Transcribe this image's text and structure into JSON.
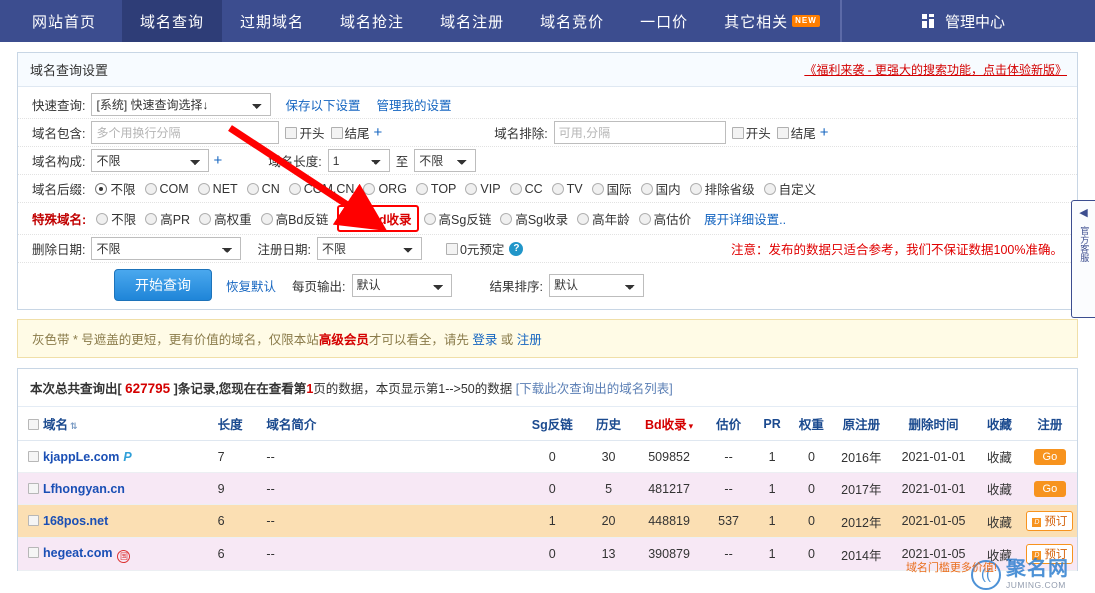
{
  "nav": {
    "items": [
      {
        "label": "网站首页",
        "active": false,
        "new": false
      },
      {
        "label": "域名查询",
        "active": true,
        "new": false
      },
      {
        "label": "过期域名",
        "active": false,
        "new": false
      },
      {
        "label": "域名抢注",
        "active": false,
        "new": false
      },
      {
        "label": "域名注册",
        "active": false,
        "new": false
      },
      {
        "label": "域名竞价",
        "active": false,
        "new": false
      },
      {
        "label": "一口价",
        "active": false,
        "new": false
      },
      {
        "label": "其它相关",
        "active": false,
        "new": true
      }
    ],
    "new_badge": "NEW",
    "admin_label": "管理中心"
  },
  "panel": {
    "title": "域名查询设置",
    "promo_link": "《福利来袭 - 更强大的搜索功能，点击体验新版》",
    "quick": {
      "label": "快速查询:",
      "value": "[系统] 快速查询选择↓",
      "save_link": "保存以下设置",
      "manage_link": "管理我的设置"
    },
    "contain": {
      "label": "域名包含:",
      "placeholder": "多个用换行分隔",
      "value": "",
      "cb_start": "开头",
      "cb_end": "结尾",
      "plus": "+"
    },
    "exclude": {
      "label": "域名排除:",
      "placeholder": "可用,分隔",
      "value": "",
      "cb_start": "开头",
      "cb_end": "结尾",
      "plus": "+"
    },
    "compose": {
      "label": "域名构成:",
      "value": "不限",
      "plus": "+"
    },
    "length": {
      "label": "域名长度:",
      "from": "1",
      "to_label": "至",
      "to": "不限"
    },
    "suffix": {
      "label": "域名后缀:",
      "options": [
        {
          "label": "不限",
          "selected": true
        },
        {
          "label": "COM",
          "selected": false
        },
        {
          "label": "NET",
          "selected": false
        },
        {
          "label": "CN",
          "selected": false
        },
        {
          "label": "COM.CN",
          "selected": false
        },
        {
          "label": "ORG",
          "selected": false
        },
        {
          "label": "TOP",
          "selected": false
        },
        {
          "label": "VIP",
          "selected": false
        },
        {
          "label": "CC",
          "selected": false
        },
        {
          "label": "TV",
          "selected": false
        },
        {
          "label": "国际",
          "selected": false
        },
        {
          "label": "国内",
          "selected": false
        },
        {
          "label": "排除省级",
          "selected": false
        },
        {
          "label": "自定义",
          "selected": false
        }
      ]
    },
    "special": {
      "label": "特殊域名:",
      "options": [
        {
          "label": "不限",
          "selected": false,
          "highlight": false
        },
        {
          "label": "高PR",
          "selected": false,
          "highlight": false
        },
        {
          "label": "高权重",
          "selected": false,
          "highlight": false
        },
        {
          "label": "高Bd反链",
          "selected": false,
          "highlight": false
        },
        {
          "label": "高Bd收录",
          "selected": true,
          "highlight": true
        },
        {
          "label": "高Sg反链",
          "selected": false,
          "highlight": false
        },
        {
          "label": "高Sg收录",
          "selected": false,
          "highlight": false
        },
        {
          "label": "高年龄",
          "selected": false,
          "highlight": false
        },
        {
          "label": "高估价",
          "selected": false,
          "highlight": false
        }
      ],
      "expand_link": "展开详细设置.."
    },
    "dates": {
      "delete_label": "删除日期:",
      "delete_value": "不限",
      "reg_label": "注册日期:",
      "reg_value": "不限",
      "zero_label": "0元预定",
      "help_icon": "?",
      "warning": "注意：发布的数据只适合参考，我们不保证数据100%准确。"
    },
    "actions": {
      "query_button": "开始查询",
      "reset_link": "恢复默认",
      "perpage_label": "每页输出:",
      "perpage_value": "默认",
      "sort_label": "结果排序:",
      "sort_value": "默认"
    }
  },
  "notice": {
    "part1": "灰色带 * 号遮盖的更短，更有价值的域名，仅限本站",
    "member": "高级会员",
    "part2": "才可以看全，请先 ",
    "login": "登录",
    "or": " 或 ",
    "register": "注册"
  },
  "results": {
    "summary_1": "本次总共查询出[ ",
    "total": "627795",
    "summary_2": " ]条记录,您现在在查看第",
    "page": "1",
    "summary_3": "页的数据，本页显示第1-->50的数据 ",
    "download_link": "[下载此次查询出的域名列表]",
    "columns": [
      "域名",
      "长度",
      "域名简介",
      "Sg反链",
      "历史",
      "Bd收录",
      "估价",
      "PR",
      "权重",
      "原注册",
      "删除时间",
      "收藏",
      "注册"
    ],
    "rows": [
      {
        "domain": "kjappLe.com",
        "mark": "P",
        "mark_type": "p",
        "length": "7",
        "intro": "--",
        "sg": "0",
        "history": "30",
        "bd": "509852",
        "price": "--",
        "pr": "1",
        "weight": "0",
        "reg": "2016年",
        "delete": "2021-01-01",
        "fav": "收藏",
        "action": "Go",
        "action_type": "go"
      },
      {
        "domain": "Lfhongyan.cn",
        "mark": "",
        "mark_type": "",
        "length": "9",
        "intro": "--",
        "sg": "0",
        "history": "5",
        "bd": "481217",
        "price": "--",
        "pr": "1",
        "weight": "0",
        "reg": "2017年",
        "delete": "2021-01-01",
        "fav": "收藏",
        "action": "Go",
        "action_type": "go"
      },
      {
        "domain": "168pos.net",
        "mark": "",
        "mark_type": "",
        "length": "6",
        "intro": "--",
        "sg": "1",
        "history": "20",
        "bd": "448819",
        "price": "537",
        "pr": "1",
        "weight": "0",
        "reg": "2012年",
        "delete": "2021-01-05",
        "fav": "收藏",
        "action": "预订",
        "action_type": "book"
      },
      {
        "domain": "hegeat.com",
        "mark": "国",
        "mark_type": "cn",
        "length": "6",
        "intro": "--",
        "sg": "0",
        "history": "13",
        "bd": "390879",
        "price": "--",
        "pr": "1",
        "weight": "0",
        "reg": "2014年",
        "delete": "2021-01-05",
        "fav": "收藏",
        "action": "预订",
        "action_type": "book"
      }
    ]
  },
  "side_panel": {
    "arrow": "◀",
    "lines": "官方客服"
  },
  "watermark": {
    "logo_mark": "((",
    "main": "聚名网",
    "sub": "JUMING.COM",
    "tagline": "域名门槛更多价值!"
  },
  "colors": {
    "nav_bg": "#3c4d8f",
    "nav_active": "#2e3d77",
    "accent_red": "#d40000",
    "link_blue": "#1565c0",
    "button_blue": "#1f85d8",
    "orange": "#f7931e",
    "highlight_border": "#ff0000"
  }
}
